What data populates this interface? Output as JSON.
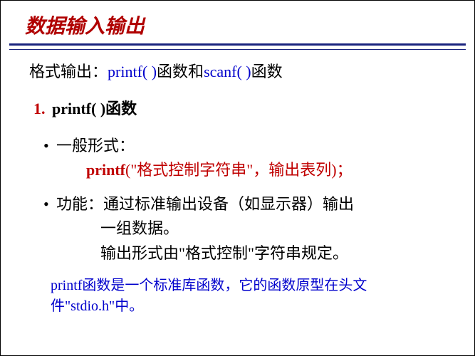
{
  "title": "数据输入输出",
  "line1": {
    "pre": "格式输出：",
    "fn1": "printf( )",
    "mid": "函数和",
    "fn2": "scanf( )",
    "post": "函数"
  },
  "section": {
    "num": "1.",
    "title": "printf( )函数"
  },
  "b1": {
    "label": "一般形式：",
    "code_fn": "printf",
    "code_rest": "(\"格式控制字符串\"，输出表列)；"
  },
  "b2": {
    "label": "功能：通过标准输出设备（如显示器）输出",
    "l2": "一组数据。",
    "l3": "输出形式由\"格式控制\"字符串规定。"
  },
  "note": "printf函数是一个标准库函数，它的函数原型在头文件\"stdio.h\"中。"
}
